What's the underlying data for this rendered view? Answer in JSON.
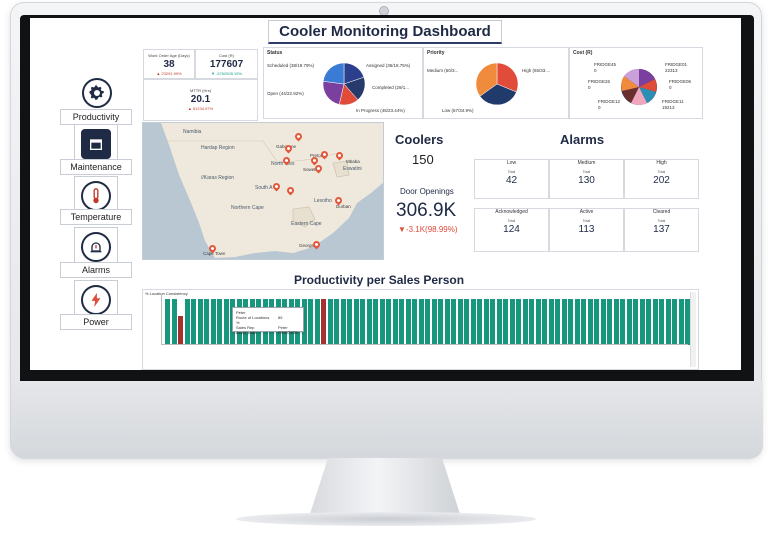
{
  "dashboard": {
    "title": "Cooler Monitoring Dashboard"
  },
  "nav": {
    "items": [
      {
        "label": "Productivity",
        "icon": "gear-icon"
      },
      {
        "label": "Maintenance",
        "icon": "calendar-icon"
      },
      {
        "label": "Temperature",
        "icon": "thermometer-icon"
      },
      {
        "label": "Alarms",
        "icon": "alarm-icon"
      },
      {
        "label": "Power",
        "icon": "power-icon"
      }
    ]
  },
  "kpis": {
    "work_order_age": {
      "label": "Work Order Age (Days)",
      "value": "38",
      "delta": "▲ 23291.99%"
    },
    "cost": {
      "label": "Cost (R)",
      "value": "177607",
      "delta": "▼ -5762505.15%"
    },
    "mttr": {
      "label": "MTTR (Hrs)",
      "value": "20.1",
      "delta": "▲ 51234.97%"
    }
  },
  "status": {
    "title": "Status",
    "labels": [
      "Scheduled (38/19.79%)",
      "Assigned (36/18.75%)",
      "Completed (29/1...",
      "In Progress (45/23.44%)",
      "Open (44/22.92%)"
    ],
    "chart_data": {
      "type": "pie",
      "categories": [
        "Scheduled",
        "Assigned",
        "Completed",
        "In Progress",
        "Open"
      ],
      "values": [
        38,
        36,
        29,
        45,
        44
      ],
      "colors": [
        "#2b3f8c",
        "#263a6b",
        "#e04b3a",
        "#7b3fa0",
        "#3a7bd5"
      ]
    }
  },
  "priority": {
    "title": "Priority",
    "labels": [
      "Medium (60/3...",
      "High (65/33....",
      "Low (67/34.9%)"
    ],
    "chart_data": {
      "type": "pie",
      "categories": [
        "Medium",
        "High",
        "Low"
      ],
      "values": [
        60,
        65,
        67
      ],
      "colors": [
        "#e04b3a",
        "#1f3a6b",
        "#f08a3c"
      ]
    }
  },
  "costchart": {
    "title": "Cost (R)",
    "labels": [
      "FRIDGE45",
      "0",
      "FRIDGE01",
      "22313",
      "FRIDGE26",
      "0",
      "FRIDGE06",
      "0",
      "FRIDGE12",
      "0",
      "FRIDGE11",
      "19213"
    ]
  },
  "map": {
    "labels": {
      "namibia": "Namibia",
      "hardap": "Hardap Region",
      "karas": "//Karas Region",
      "gaborone": "Gaborone",
      "pretoria": "Pretoria",
      "northwest": "North Wes",
      "soweto": "Soweto",
      "mbaba": "Mbaba",
      "eswatini": "Eswatini",
      "south": "South A",
      "lesotho": "Lesotho",
      "durban": "Durban",
      "northerncape": "Northern Cape",
      "capetown": "Cape Town",
      "eastern": "Eastern Cape",
      "george": "George"
    }
  },
  "coolers": {
    "title": "Coolers",
    "count": "150",
    "door_label": "Door Openings",
    "door_value": "306.9K",
    "door_delta": "▼-3.1K(98.99%)"
  },
  "alarms": {
    "title": "Alarms",
    "row1": [
      {
        "head": "Low",
        "sub": "Total",
        "value": "42"
      },
      {
        "head": "Medium",
        "sub": "Total",
        "value": "130"
      },
      {
        "head": "High",
        "sub": "Total",
        "value": "202"
      }
    ],
    "row2": [
      {
        "head": "Acknowledged",
        "sub": "Total",
        "value": "124"
      },
      {
        "head": "Active",
        "sub": "Total",
        "value": "113"
      },
      {
        "head": "Cleared",
        "sub": "Total",
        "value": "137"
      }
    ]
  },
  "productivity": {
    "title": "Productivity per Sales Person",
    "chart_label": "% Location Consistency",
    "tooltip": {
      "name": "Peter",
      "rows": [
        [
          "Route of Locations %",
          "85"
        ],
        [
          "Sales Rep",
          "Peter"
        ],
        [
          "asset_code",
          "FRIDGE35"
        ]
      ]
    },
    "chart_data": {
      "type": "bar",
      "xlabel": "",
      "ylabel": "% Location Consistency",
      "ylim": [
        0,
        100
      ],
      "values": [
        88,
        88,
        55,
        88,
        88,
        88,
        88,
        88,
        88,
        88,
        88,
        88,
        88,
        88,
        88,
        88,
        88,
        88,
        88,
        88,
        88,
        88,
        88,
        88,
        88,
        88,
        88,
        88,
        88,
        88,
        88,
        88,
        88,
        88,
        88,
        88,
        88,
        88,
        88,
        88,
        88,
        88,
        88,
        88,
        88,
        88,
        88,
        88,
        88,
        88,
        88,
        88,
        88,
        88,
        88,
        88,
        88,
        88,
        88,
        88,
        88,
        88,
        88,
        88,
        88,
        88,
        88,
        88,
        88,
        88,
        88,
        88,
        88,
        88,
        88,
        88,
        88,
        88,
        88,
        88,
        88
      ],
      "highlight": [
        2,
        24
      ],
      "highlight_color": "#a3312f",
      "bar_color": "#17987e"
    }
  }
}
